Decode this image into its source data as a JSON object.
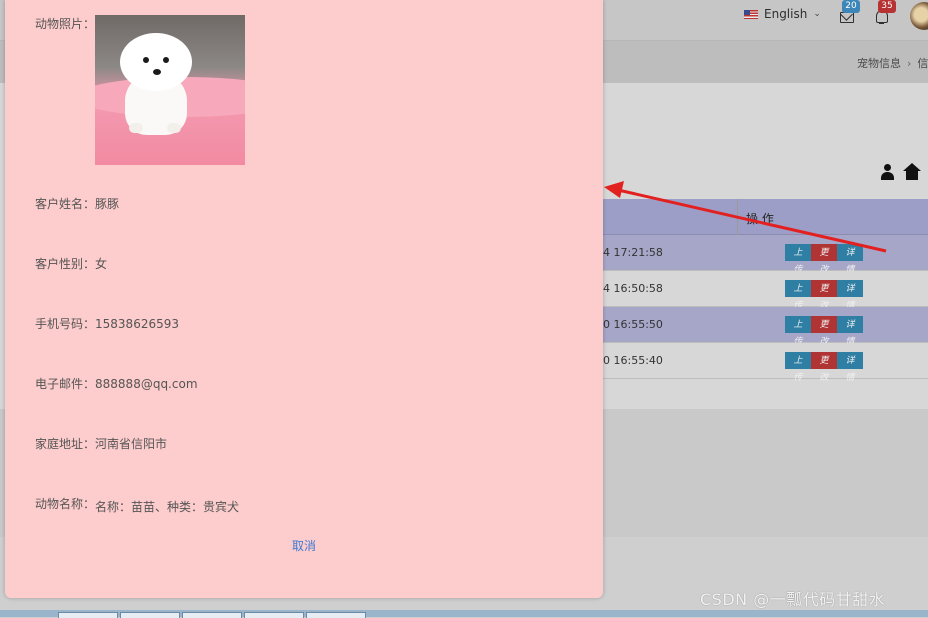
{
  "header": {
    "language": "English",
    "mail_count": "20",
    "notify_count": "35"
  },
  "breadcrumb": {
    "item1": "宠物信息",
    "separator": "›",
    "item2": "信"
  },
  "table": {
    "op_header": "操 作",
    "rows": [
      {
        "time": "4 17:21:58",
        "upload": "上传",
        "change": "更改",
        "detail": "详情"
      },
      {
        "time": "4 16:50:58",
        "upload": "上传",
        "change": "更改",
        "detail": "详情"
      },
      {
        "time": "0 16:55:50",
        "upload": "上传",
        "change": "更改",
        "detail": "详情"
      },
      {
        "time": "0 16:55:40",
        "upload": "上传",
        "change": "更改",
        "detail": "详情"
      }
    ]
  },
  "modal": {
    "photo_label": "动物照片：",
    "customer_name_label": "客户姓名：",
    "customer_name": "豚豚",
    "gender_label": "客户性别：",
    "gender": "女",
    "phone_label": "手机号码：",
    "phone": "15838626593",
    "email_label": "电子邮件：",
    "email": "888888@qq.com",
    "address_label": "家庭地址：",
    "address": "河南省信阳市",
    "animal_name_label": "动物名称：",
    "animal_name": "名称：苗苗、种类：贵宾犬",
    "cancel": "取消"
  },
  "watermark": "CSDN @一瓢代码甘甜水",
  "colors": {
    "modal_bg": "#fdcccc",
    "table_alt_row": "#a6a6c8",
    "btn_upload": "#2f7fa4",
    "btn_change": "#b13434",
    "arrow": "#e32020",
    "cancel_link": "#3d7bd6"
  }
}
